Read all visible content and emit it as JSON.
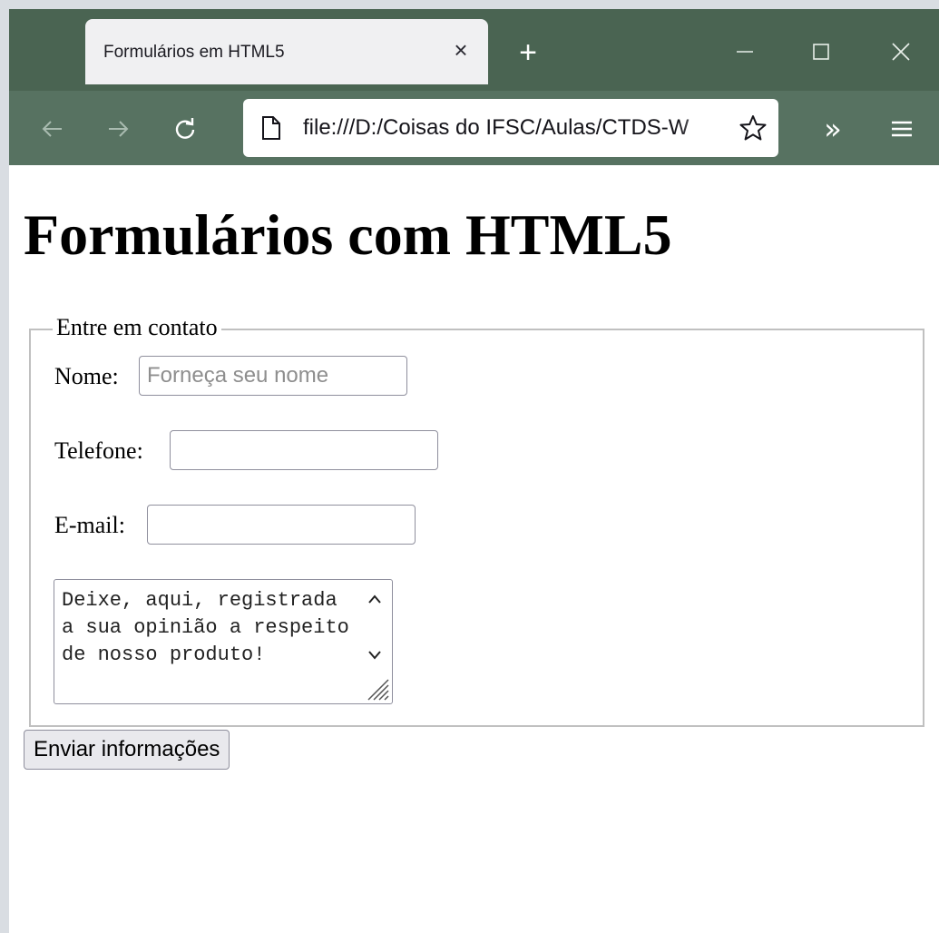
{
  "browser": {
    "tab_title": "Formulários em HTML5",
    "tab_close_glyph": "×",
    "new_tab_glyph": "+",
    "url": "file:///D:/Coisas do IFSC/Aulas/CTDS-W",
    "overflow_glyph": "»",
    "colors": {
      "titlebar": "#4a6452",
      "toolbar": "#577261"
    }
  },
  "page": {
    "heading": "Formulários com HTML5",
    "fieldset_legend": "Entre em contato",
    "fields": {
      "name_label": "Nome:",
      "name_placeholder": "Forneça seu nome",
      "phone_label": "Telefone:",
      "email_label": "E-mail:",
      "message_text": "Deixe, aqui, registrada a sua opinião a respeito de nosso produto!"
    },
    "submit_label": "Enviar informações"
  }
}
